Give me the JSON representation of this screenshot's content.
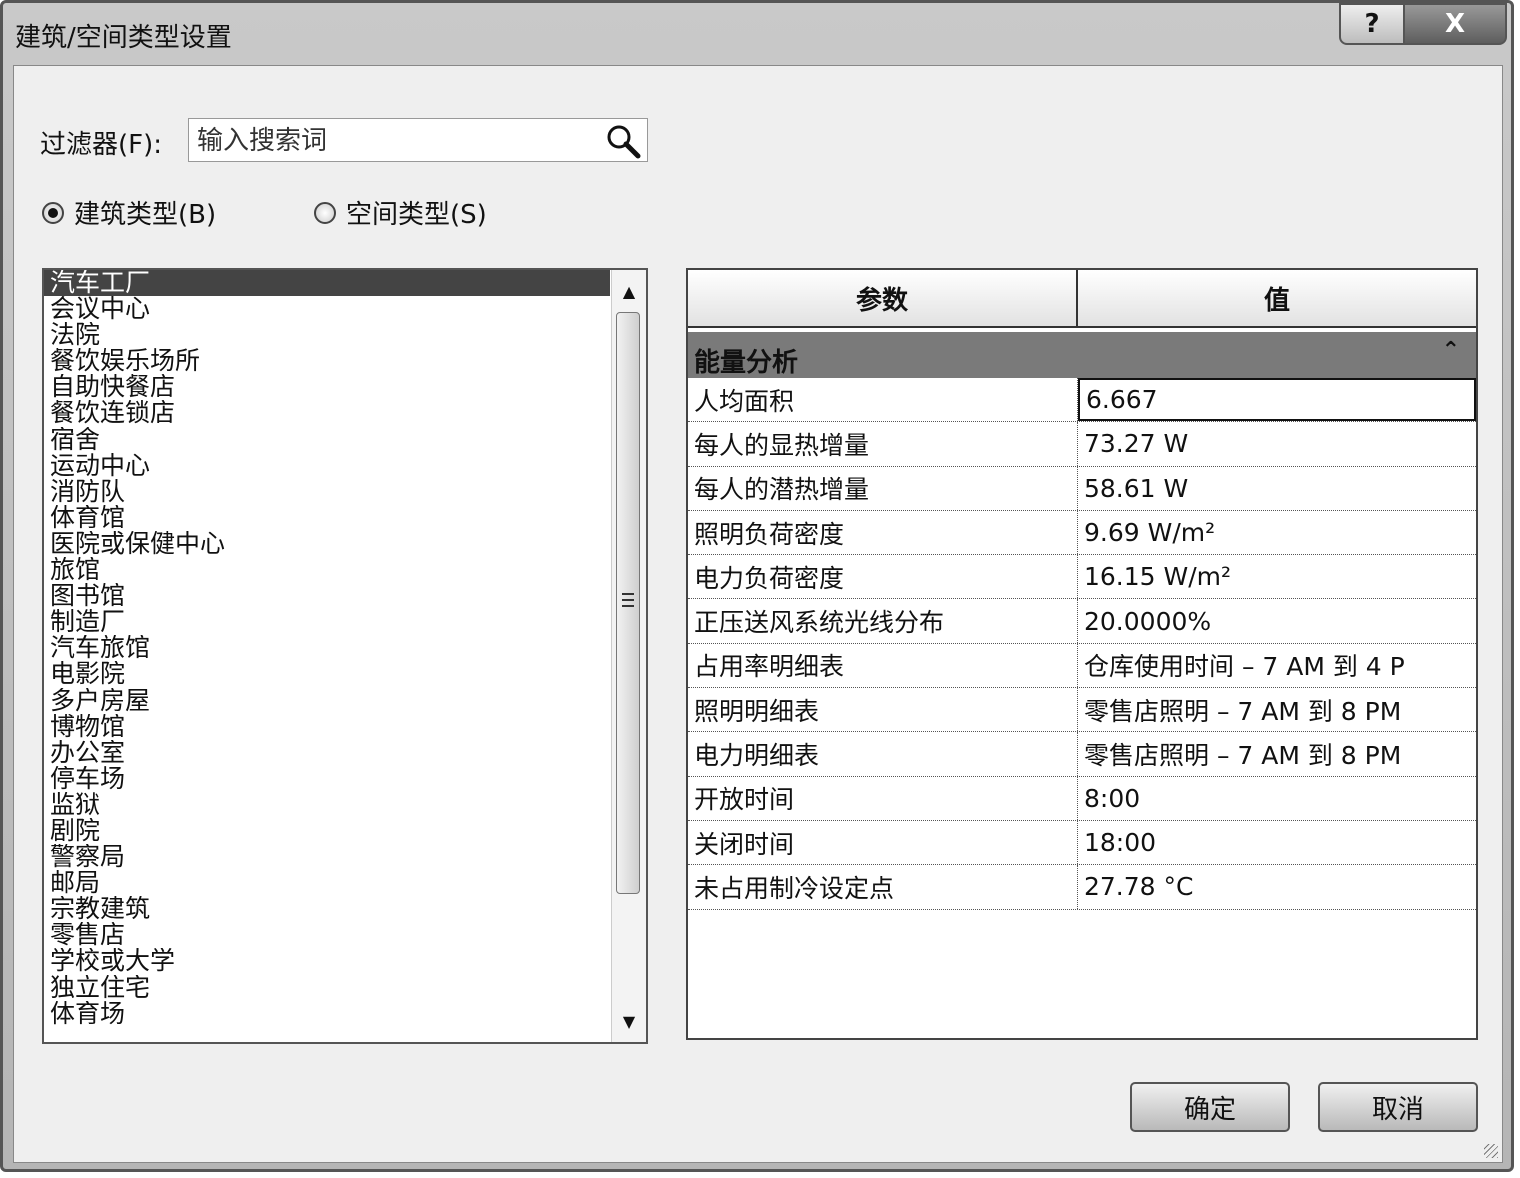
{
  "window": {
    "title": "建筑/空间类型设置",
    "help_label": "?",
    "close_label": "X"
  },
  "filter": {
    "label": "过滤器(F):",
    "placeholder": "输入搜索词",
    "value": ""
  },
  "radios": {
    "building": {
      "label": "建筑类型(B)",
      "checked": true
    },
    "space": {
      "label": "空间类型(S)",
      "checked": false
    }
  },
  "types_list": {
    "selected": "汽车工厂",
    "items": [
      "汽车工厂",
      "会议中心",
      "法院",
      "餐饮娱乐场所",
      "自助快餐店",
      "餐饮连锁店",
      "宿舍",
      "运动中心",
      "消防队",
      "体育馆",
      "医院或保健中心",
      "旅馆",
      "图书馆",
      "制造厂",
      "汽车旅馆",
      "电影院",
      "多户房屋",
      "博物馆",
      "办公室",
      "停车场",
      "监狱",
      "剧院",
      "警察局",
      "邮局",
      "宗教建筑",
      "零售店",
      "学校或大学",
      "独立住宅",
      "体育场"
    ]
  },
  "grid": {
    "header_param": "参数",
    "header_value": "值",
    "group": "能量分析",
    "rows": [
      {
        "param": "人均面积",
        "value": "6.667"
      },
      {
        "param": "每人的显热增量",
        "value": "73.27 W"
      },
      {
        "param": "每人的潜热增量",
        "value": "58.61 W"
      },
      {
        "param": "照明负荷密度",
        "value": "9.69 W/m²"
      },
      {
        "param": "电力负荷密度",
        "value": "16.15 W/m²"
      },
      {
        "param": "正压送风系统光线分布",
        "value": "20.0000%"
      },
      {
        "param": "占用率明细表",
        "value": "仓库使用时间 – 7 AM 到 4 P"
      },
      {
        "param": "照明明细表",
        "value": "零售店照明 – 7 AM 到 8 PM"
      },
      {
        "param": "电力明细表",
        "value": "零售店照明 – 7 AM 到 8 PM"
      },
      {
        "param": "开放时间",
        "value": "8:00"
      },
      {
        "param": "关闭时间",
        "value": "18:00"
      },
      {
        "param": "未占用制冷设定点",
        "value": "27.78 °C"
      }
    ]
  },
  "buttons": {
    "ok": "确定",
    "cancel": "取消"
  },
  "icons": {
    "search": "search-icon",
    "collapse": "double-chevron-up-icon",
    "scroll_up": "scroll-up-arrow-icon",
    "scroll_down": "scroll-down-arrow-icon"
  }
}
